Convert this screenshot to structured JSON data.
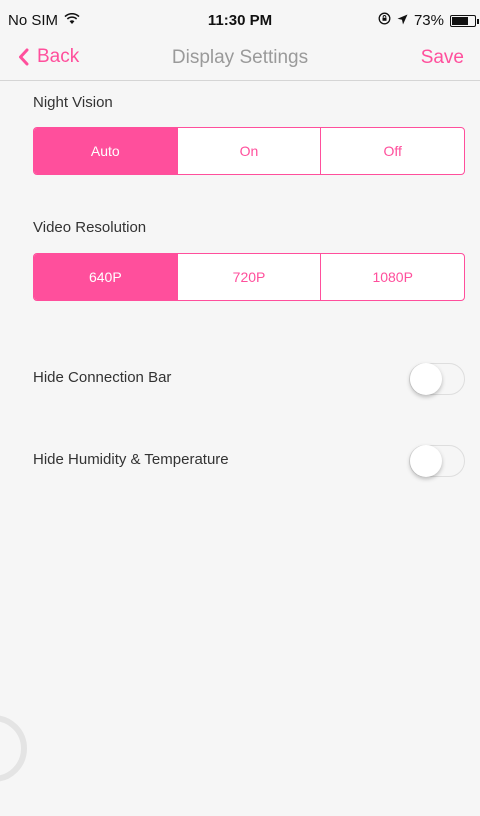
{
  "status_bar": {
    "carrier": "No SIM",
    "time": "11:30 PM",
    "battery_percent": "73%",
    "battery_level": 0.73
  },
  "nav": {
    "back_label": "Back",
    "title": "Display Settings",
    "save_label": "Save"
  },
  "night_vision": {
    "label": "Night Vision",
    "options": [
      "Auto",
      "On",
      "Off"
    ],
    "selected": "Auto"
  },
  "video_resolution": {
    "label": "Video Resolution",
    "options": [
      "640P",
      "720P",
      "1080P"
    ],
    "selected": "640P"
  },
  "toggles": [
    {
      "label": "Hide Connection Bar",
      "on": false
    },
    {
      "label": "Hide Humidity & Temperature",
      "on": false
    }
  ],
  "colors": {
    "accent": "#ff4f9c",
    "background": "#f6f6f6",
    "title_gray": "#9a9a9a"
  },
  "icons": [
    "wifi-icon",
    "lock-rotation-icon",
    "location-arrow-icon",
    "battery-icon",
    "chevron-left-icon"
  ]
}
